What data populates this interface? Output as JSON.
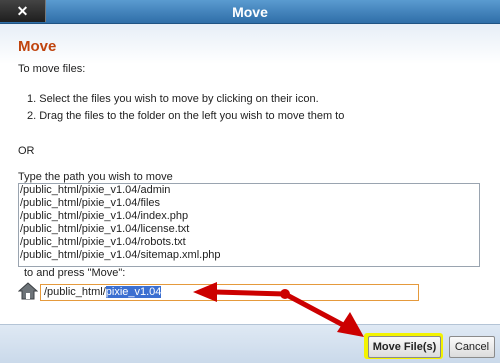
{
  "window": {
    "title": "Move",
    "close_label": "✕"
  },
  "dialog": {
    "heading": "Move",
    "intro": "To move files:",
    "steps": [
      "1.  Select the files you wish to move by clicking on their icon.",
      "2.  Drag the files to the folder on the left you wish to move them to"
    ],
    "or_label": "OR",
    "path_instruction": "Type the path you wish to move",
    "files": [
      "/public_html/pixie_v1.04/admin",
      "/public_html/pixie_v1.04/files",
      "/public_html/pixie_v1.04/index.php",
      "/public_html/pixie_v1.04/license.txt",
      "/public_html/pixie_v1.04/robots.txt",
      "/public_html/pixie_v1.04/sitemap.xml.php"
    ],
    "press_instruction": "to and press \"Move\":",
    "destination": {
      "value_prefix": "/public_html/",
      "value_selected": "pixie_v1.04"
    }
  },
  "footer": {
    "move_button": "Move File(s)",
    "cancel_button": "Cancel"
  },
  "colors": {
    "titlebar": "#3b7fc0",
    "heading": "#c0440e",
    "arrow": "#cc0000",
    "highlight": "#f3f300",
    "selection": "#3b6fd1"
  },
  "icons": [
    "close-icon",
    "home-icon",
    "arrow-annotation"
  ]
}
